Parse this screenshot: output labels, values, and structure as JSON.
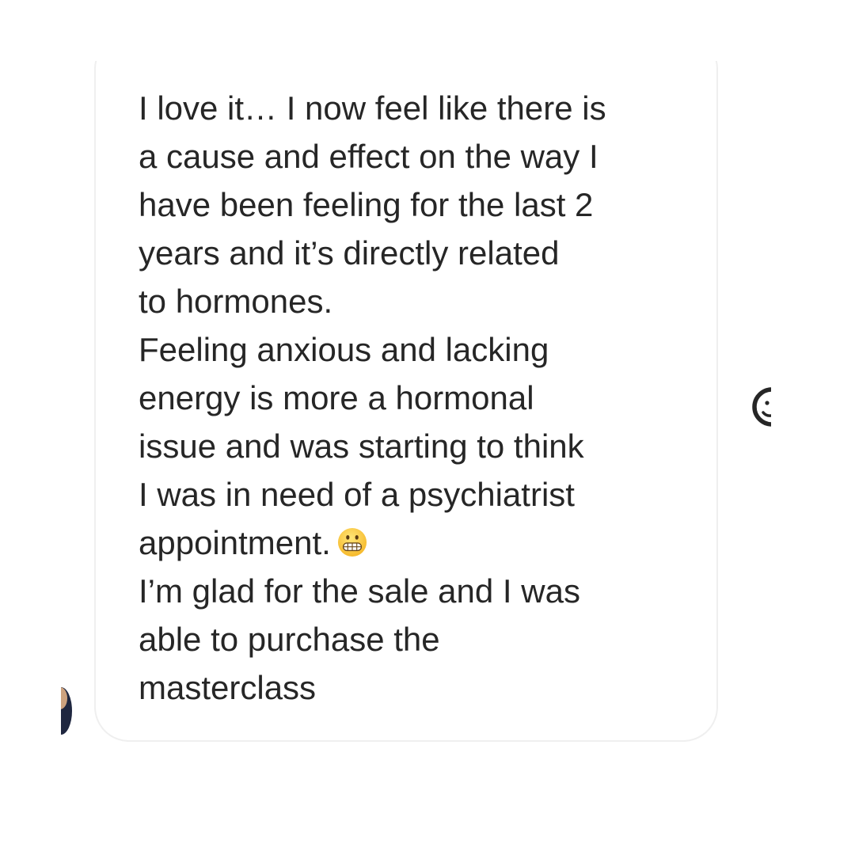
{
  "message": {
    "lines": [
      "I love it… I now feel like there is",
      "a cause and effect on the way I",
      "have been feeling for the last 2",
      "years and it’s directly related",
      "to hormones.",
      "Feeling anxious and lacking",
      "energy is more a hormonal",
      "issue and was starting to think",
      "I was in need of a psychiatrist",
      "appointment.",
      "I’m glad for the sale and I was",
      "able to purchase the",
      "masterclass"
    ],
    "emoji": "grimacing-face-emoji"
  },
  "icons": {
    "react": "smiley-face-icon",
    "sender_avatar": "avatar"
  },
  "colors": {
    "text": "#262626",
    "bubble_border": "#efefef",
    "background": "#ffffff"
  }
}
